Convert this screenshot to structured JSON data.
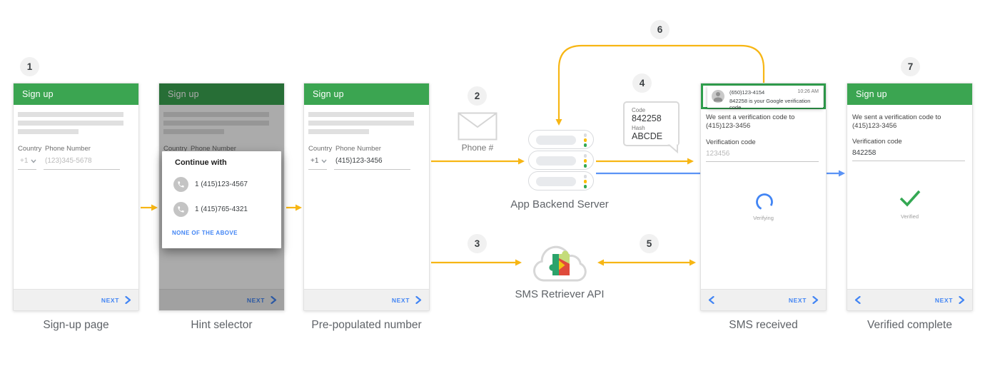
{
  "steps": [
    "1",
    "2",
    "3",
    "4",
    "5",
    "6",
    "7"
  ],
  "phones": {
    "signup": {
      "header": "Sign up",
      "country_label": "Country",
      "phone_label": "Phone Number",
      "country_value": "+1",
      "phone_placeholder": "(123)345-5678",
      "next_label": "NEXT",
      "caption": "Sign-up page"
    },
    "hint": {
      "header": "Sign up",
      "dialog_title": "Continue with",
      "option1": "1 (415)123-4567",
      "option2": "1 (415)765-4321",
      "none_label": "NONE OF THE ABOVE",
      "next_label": "NEXT",
      "caption": "Hint selector"
    },
    "prepopulated": {
      "header": "Sign up",
      "country_label": "Country",
      "phone_label": "Phone Number",
      "country_value": "+1",
      "phone_value": "(415)123-3456",
      "next_label": "NEXT",
      "caption": "Pre-populated number"
    },
    "sms": {
      "notification": {
        "sender": "(650)123-4154",
        "time": "10:26 AM",
        "message": "842258 is your Google verification code"
      },
      "line1": "We sent a verification code to",
      "line2": "(415)123-3456",
      "code_label": "Verification code",
      "code_placeholder": "123456",
      "status": "Verifying",
      "next_label": "NEXT",
      "caption": "SMS received"
    },
    "verified": {
      "header": "Sign up",
      "line1": "We sent a verification code to",
      "line2": "(415)123-3456",
      "code_label": "Verification code",
      "code_value": "842258",
      "status": "Verified",
      "next_label": "NEXT",
      "caption": "Verified complete"
    }
  },
  "flow": {
    "phone_number_label": "Phone #",
    "server_label": "App Backend Server",
    "api_label": "SMS Retriever API",
    "callout": {
      "code_label": "Code",
      "code_value": "842258",
      "hash_label": "Hash",
      "hash_value": "ABCDE"
    }
  },
  "colors": {
    "green": "#34A853",
    "header_green": "#3BA551",
    "arrow_yellow": "#F7B614",
    "arrow_blue": "#5B93F5",
    "link_blue": "#4285F4"
  }
}
